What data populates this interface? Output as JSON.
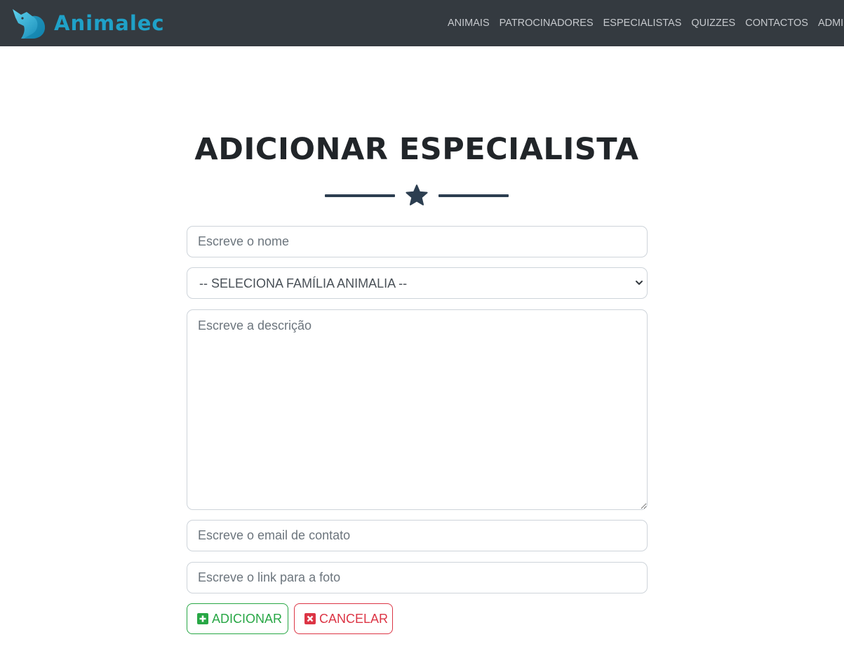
{
  "navbar": {
    "brand": "Animalec",
    "links": [
      "ANIMAIS",
      "PATROCINADORES",
      "ESPECIALISTAS",
      "QUIZZES",
      "CONTACTOS",
      "ADMIN"
    ]
  },
  "page": {
    "title": "ADICIONAR ESPECIALISTA"
  },
  "form": {
    "nome_placeholder": "Escreve o nome",
    "familia_selected": "-- SELECIONA FAMÍLIA ANIMALIA --",
    "descricao_placeholder": "Escreve a descrição",
    "email_placeholder": "Escreve o email de contato",
    "foto_placeholder": "Escreve o link para a foto",
    "add_label": "ADICIONAR",
    "cancel_label": "CANCELAR"
  },
  "colors": {
    "navbar_bg": "#343a40",
    "brand": "#1fa1c8",
    "accent_dark": "#2c3e50",
    "success": "#28a745",
    "danger": "#dc3545"
  },
  "icons": {
    "brand": "fox-logo-icon",
    "divider": "star-icon",
    "add": "plus-square-icon",
    "cancel": "close-square-icon",
    "select": "chevron-down-icon"
  }
}
